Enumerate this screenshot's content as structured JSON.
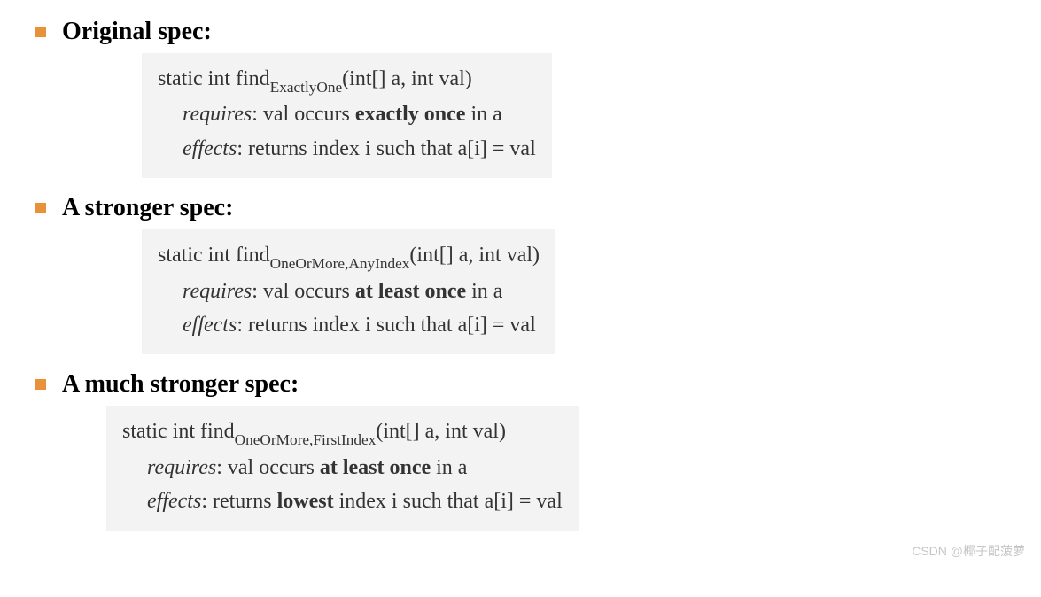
{
  "sections": [
    {
      "heading": "Original spec:",
      "code": {
        "sig_prefix": "static int find",
        "sig_sub": "ExactlyOne",
        "sig_suffix": "(int[] a, int val)",
        "requires_label": "requires",
        "requires_pre": ": val occurs ",
        "requires_bold": "exactly once",
        "requires_post": " in a",
        "effects_label": "effects",
        "effects_pre": ":  returns ",
        "effects_bold": "",
        "effects_post": "index i such that a[i] = val"
      },
      "wide": false
    },
    {
      "heading": "A stronger spec:",
      "code": {
        "sig_prefix": "static int find",
        "sig_sub": "OneOrMore,AnyIndex",
        "sig_suffix": "(int[] a, int val)",
        "requires_label": "requires",
        "requires_pre": ": val occurs ",
        "requires_bold": "at least once",
        "requires_post": " in a",
        "effects_label": "effects",
        "effects_pre": ":  returns ",
        "effects_bold": "",
        "effects_post": "index i such that a[i] = val"
      },
      "wide": false
    },
    {
      "heading": "A much stronger spec:",
      "code": {
        "sig_prefix": "static int find",
        "sig_sub": "OneOrMore,FirstIndex",
        "sig_suffix": "(int[] a, int val)",
        "requires_label": "requires",
        "requires_pre": ": val occurs ",
        "requires_bold": "at least once",
        "requires_post": " in a",
        "effects_label": "effects",
        "effects_pre": ":  returns ",
        "effects_bold": "lowest",
        "effects_post": " index i such that a[i] = val"
      },
      "wide": true
    }
  ],
  "watermark": "CSDN @椰子配菠萝"
}
